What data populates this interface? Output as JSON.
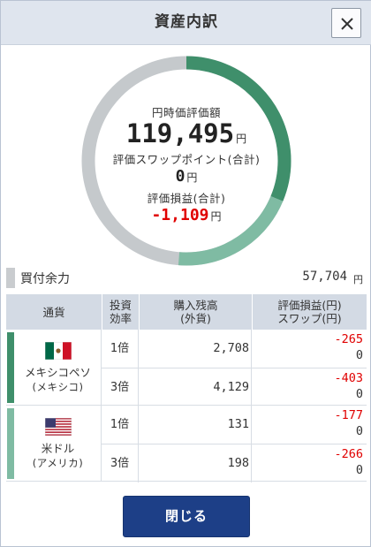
{
  "header": {
    "title": "資産内訳"
  },
  "summary": {
    "valuation_label": "円時価評価額",
    "valuation_value": "119,495",
    "valuation_unit": "円",
    "swap_label": "評価スワップポイント(合計)",
    "swap_value": "0",
    "swap_unit": "円",
    "pl_label": "評価損益(合計)",
    "pl_value": "-1,109",
    "pl_unit": "円"
  },
  "donut": {
    "colors": {
      "gray": "#c5c9cc",
      "mxn": "#3f8f6b",
      "usd": "#7fbba3"
    },
    "mxn_fraction": 0.313,
    "usd_fraction": 0.199
  },
  "buying_power": {
    "label": "買付余力",
    "value": "57,704",
    "unit": "円"
  },
  "table": {
    "headers": {
      "currency": "通貨",
      "leverage_1": "投資",
      "leverage_2": "効率",
      "position_1": "購入残高",
      "position_2": "(外貨)",
      "pl_1": "評価損益(円)",
      "pl_2": "スワップ(円)"
    },
    "groups": [
      {
        "name": "メキシコペソ",
        "sub": "(メキシコ)",
        "bar_color": "#3f8f6b",
        "rows": [
          {
            "leverage": "1倍",
            "position": "2,708",
            "pl": "-265",
            "swap": "0"
          },
          {
            "leverage": "3倍",
            "position": "4,129",
            "pl": "-403",
            "swap": "0"
          }
        ]
      },
      {
        "name": "米ドル",
        "sub": "(アメリカ)",
        "bar_color": "#7fbba3",
        "rows": [
          {
            "leverage": "1倍",
            "position": "131",
            "pl": "-177",
            "swap": "0"
          },
          {
            "leverage": "3倍",
            "position": "198",
            "pl": "-266",
            "swap": "0"
          }
        ]
      }
    ]
  },
  "footer": {
    "close_label": "閉じる"
  }
}
